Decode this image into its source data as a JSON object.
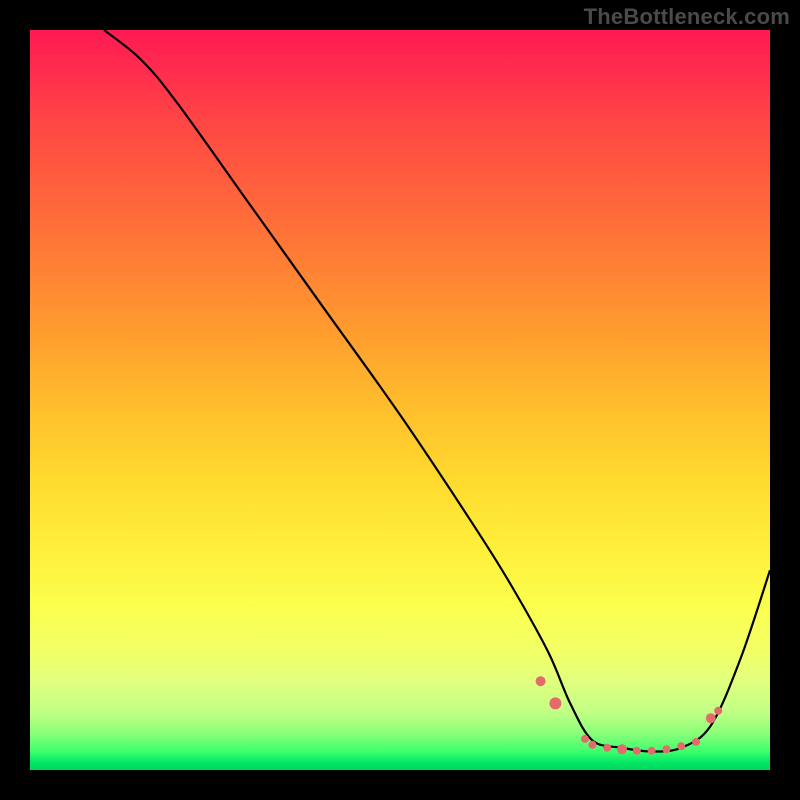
{
  "watermark": "TheBottleneck.com",
  "chart_data": {
    "type": "line",
    "title": "",
    "xlabel": "",
    "ylabel": "",
    "xlim": [
      0,
      100
    ],
    "ylim": [
      0,
      100
    ],
    "grid": false,
    "legend": false,
    "series": [
      {
        "name": "bottleneck-curve",
        "x": [
          10,
          15,
          20,
          30,
          40,
          50,
          60,
          65,
          70,
          73,
          76,
          80,
          84,
          88,
          92,
          96,
          100
        ],
        "y": [
          100,
          96,
          90,
          76,
          62,
          48,
          33,
          25,
          16,
          9,
          4,
          3,
          2.5,
          3,
          6,
          15,
          27
        ]
      }
    ],
    "markers": {
      "name": "highlighted-points",
      "color": "#e46b6b",
      "points": [
        {
          "x": 69,
          "y": 12,
          "r": 5
        },
        {
          "x": 71,
          "y": 9,
          "r": 6
        },
        {
          "x": 75,
          "y": 4.2,
          "r": 4
        },
        {
          "x": 76,
          "y": 3.4,
          "r": 4
        },
        {
          "x": 78,
          "y": 3.0,
          "r": 4
        },
        {
          "x": 80,
          "y": 2.8,
          "r": 5
        },
        {
          "x": 82,
          "y": 2.6,
          "r": 4
        },
        {
          "x": 84,
          "y": 2.6,
          "r": 4
        },
        {
          "x": 86,
          "y": 2.8,
          "r": 4
        },
        {
          "x": 88,
          "y": 3.2,
          "r": 4
        },
        {
          "x": 90,
          "y": 3.8,
          "r": 4
        },
        {
          "x": 92,
          "y": 7,
          "r": 5
        },
        {
          "x": 93,
          "y": 8,
          "r": 4
        }
      ]
    }
  },
  "colors": {
    "frame": "#000000",
    "curve": "#000000",
    "marker": "#e46b6b",
    "watermark": "#4a4a4a"
  }
}
